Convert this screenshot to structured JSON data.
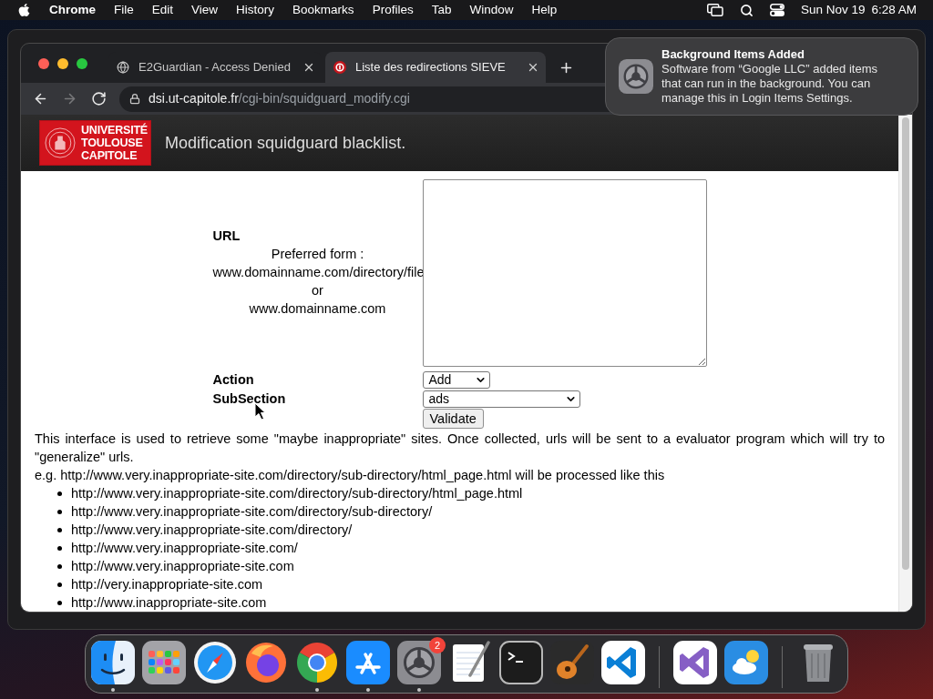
{
  "menubar": {
    "app": "Chrome",
    "menus": [
      "File",
      "Edit",
      "View",
      "History",
      "Bookmarks",
      "Profiles",
      "Tab",
      "Window",
      "Help"
    ],
    "date": "Sun Nov 19",
    "time": "6:28 AM"
  },
  "browser": {
    "tabs": [
      {
        "title": "E2Guardian - Access Denied",
        "selected": false
      },
      {
        "title": "Liste des redirections SIEVE",
        "selected": true
      }
    ],
    "nav": [
      {
        "kind": "back",
        "disabled": false
      },
      {
        "kind": "forward",
        "disabled": true
      },
      {
        "kind": "reload",
        "disabled": false
      }
    ],
    "address": {
      "host": "dsi.ut-capitole.fr",
      "path": "/cgi-bin/squidguard_modify.cgi"
    }
  },
  "page": {
    "logo_lines": [
      "UNIVERSITÉ",
      "TOULOUSE",
      "CAPITOLE"
    ],
    "title": "Modification squidguard blacklist.",
    "form": {
      "url_label": "URL",
      "url_hint": [
        "Preferred form :",
        "www.domainname.com/directory/file",
        "or",
        "www.domainname.com"
      ],
      "selects": [
        {
          "label": "Action",
          "value": "Add"
        },
        {
          "label": "SubSection",
          "value": "ads"
        }
      ],
      "submit": "Validate"
    },
    "description": "This interface is used to retrieve some \"maybe inappropriate\" sites. Once collected, urls will be sent to a evaluator program which will try to \"generalize\" urls.",
    "example": "e.g. http://www.very.inappropriate-site.com/directory/sub-directory/html_page.html will be processed like this",
    "urls": [
      "http://www.very.inappropriate-site.com/directory/sub-directory/html_page.html",
      "http://www.very.inappropriate-site.com/directory/sub-directory/",
      "http://www.very.inappropriate-site.com/directory/",
      "http://www.very.inappropriate-site.com/",
      "http://www.very.inappropriate-site.com",
      "http://very.inappropriate-site.com",
      "http://www.inappropriate-site.com"
    ]
  },
  "notification": {
    "title": "Background Items Added",
    "body": "Software from “Google LLC” added items that can run in the background. You can manage this in Login Items Settings."
  },
  "dock": {
    "sections": [
      [
        {
          "running": true
        },
        {
          "running": false
        },
        {
          "running": false
        },
        {
          "running": false
        },
        {
          "running": true
        },
        {
          "running": true
        },
        {
          "running": true,
          "badge": "2"
        },
        {
          "running": false
        },
        {
          "running": false
        },
        {
          "running": false
        },
        {
          "running": false
        }
      ],
      [
        {
          "running": false
        },
        {
          "running": false
        }
      ],
      [
        {
          "running": false
        }
      ]
    ]
  }
}
